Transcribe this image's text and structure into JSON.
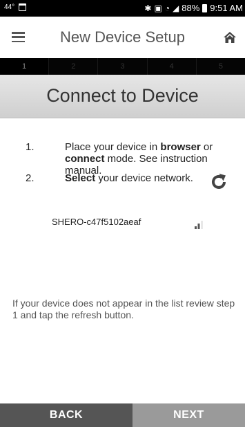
{
  "status_bar": {
    "temperature": "44°",
    "battery_percent": "88%",
    "time": "9:51 AM",
    "icons": [
      "calendar-icon",
      "bluetooth-icon",
      "nfc-icon",
      "wifi-icon",
      "cell-signal-icon",
      "battery-icon"
    ]
  },
  "app_bar": {
    "title": "New Device Setup",
    "left_icon": "menu-icon",
    "right_icon": "home-icon"
  },
  "steps": {
    "items": [
      "1",
      "2",
      "3",
      "4",
      "5"
    ],
    "active_index": 0
  },
  "section": {
    "title": "Connect to Device"
  },
  "instructions": [
    {
      "num": "1.",
      "parts": [
        "Place your device in ",
        "browser",
        " or ",
        "connect",
        " mode. See instruction manual."
      ]
    },
    {
      "num": "2.",
      "parts": [
        "Select",
        " your device network."
      ]
    }
  ],
  "networks": [
    {
      "name": "SHERO-c47f5102aeaf",
      "signal_icon": "signal-strength-icon"
    }
  ],
  "help_text": "If your device does not appear in the list review step 1 and tap the refresh button.",
  "buttons": {
    "back": "BACK",
    "next": "NEXT"
  },
  "colors": {
    "status_bar_bg": "#000000",
    "app_bar_text": "#555555",
    "section_header_bg": "#dcdcdc",
    "back_button_bg": "#555555",
    "next_button_bg": "#9a9a9a"
  }
}
